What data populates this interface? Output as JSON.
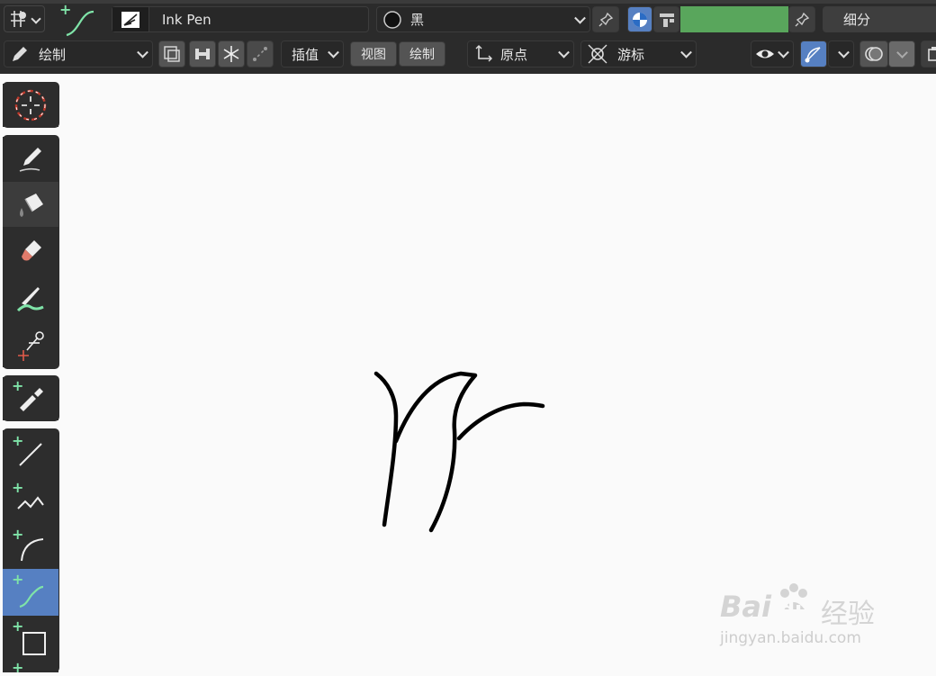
{
  "header": {
    "brush_name": "Ink Pen",
    "material_name": "黑",
    "subdivide_label": "细分"
  },
  "toolbar": {
    "mode_label": "绘制",
    "interp_label": "插值",
    "view_label": "视图",
    "draw_label": "绘制",
    "origin_label": "原点",
    "cursor_label": "游标"
  },
  "colors": {
    "bg": "#fafafa",
    "panel": "#2b2b2b",
    "accent": "#5680c2",
    "vertex_color": "#59a65c",
    "plus": "#7fe3a8",
    "stroke": "#000000"
  },
  "toolshelf": {
    "icons": [
      "cursor-icon",
      "draw-icon",
      "fill-icon",
      "erase-icon",
      "tint-icon",
      "cutter-icon",
      "eyedropper-icon",
      "line-icon",
      "polyline-icon",
      "arc-icon",
      "curve-icon",
      "box-icon"
    ]
  },
  "watermark": {
    "brand": "Bai",
    "brand2": "du",
    "cn": "经验",
    "url": "jingyan.baidu.com"
  }
}
